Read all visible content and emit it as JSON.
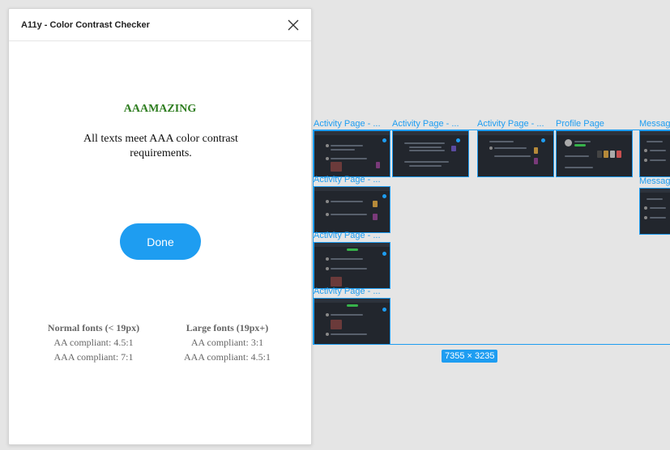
{
  "plugin": {
    "title": "A11y - Color Contrast Checker",
    "result_title": "AAAMAZING",
    "result_message": "All texts meet AAA color contrast requirements.",
    "done_label": "Done",
    "legend": {
      "normal": {
        "header": "Normal fonts (< 19px)",
        "aa": "AA compliant: 4.5:1",
        "aaa": "AAA compliant: 7:1"
      },
      "large": {
        "header": "Large fonts (19px+)",
        "aa": "AA compliant: 3:1",
        "aaa": "AAA compliant: 4.5:1"
      }
    }
  },
  "canvas": {
    "frames": [
      {
        "label": "Activity Page - ..."
      },
      {
        "label": "Activity Page - ..."
      },
      {
        "label": "Activity Page - ..."
      },
      {
        "label": "Profile Page"
      },
      {
        "label": "Messag"
      },
      {
        "label": "Activity Page - ..."
      },
      {
        "label": "Messag"
      },
      {
        "label": "Activity Page - ..."
      },
      {
        "label": "Activity Page - ..."
      }
    ],
    "selection_size": "7355 × 3235"
  },
  "colors": {
    "accent": "#1e9df1",
    "success_text": "#2e7d1f",
    "frame_bg": "#22262d"
  }
}
